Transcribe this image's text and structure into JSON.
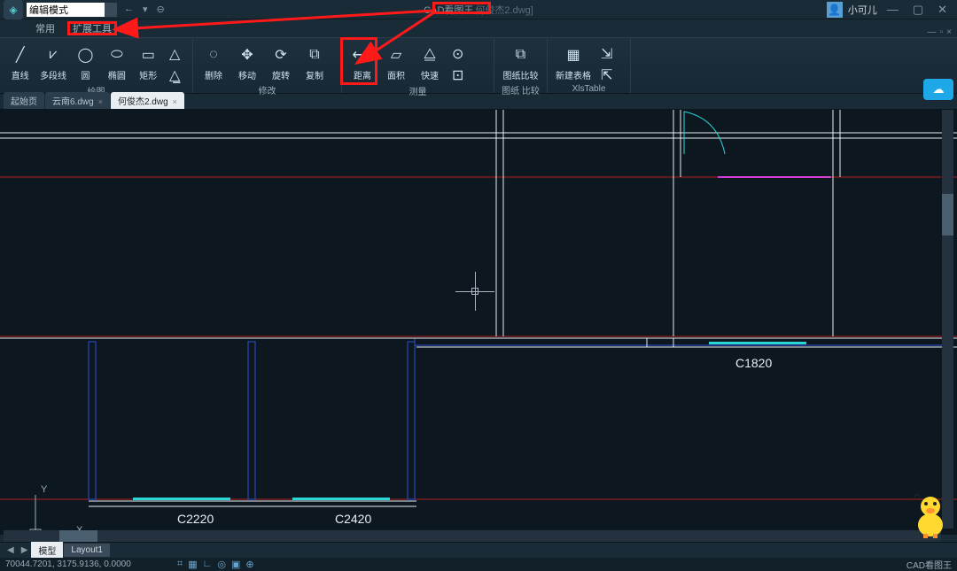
{
  "title": {
    "mode_value": "编辑模式",
    "app_badge": "CAD看图王",
    "doc_suffix": "何俊杰2.dwg]",
    "user": "小可儿"
  },
  "ribbon_tabs": {
    "common": "常用",
    "ext": "扩展工具"
  },
  "ribbon": {
    "draw": {
      "line": "直线",
      "polyline": "多段线",
      "circle": "圆",
      "ellipse": "椭圆",
      "rect": "矩形",
      "title": "绘图"
    },
    "modify": {
      "erase": "删除",
      "move": "移动",
      "rotate": "旋转",
      "copy": "复制",
      "title": "修改"
    },
    "measure": {
      "dist": "距离",
      "area": "面积",
      "quick": "快速",
      "title": "测量"
    },
    "compare": {
      "compare": "图纸比较",
      "title": "图纸 比较"
    },
    "xlstable": {
      "new": "新建表格",
      "title": "XlsTable"
    }
  },
  "file_tabs": {
    "t1": "起始页",
    "t2": "云南6.dwg",
    "t3": "何俊杰2.dwg"
  },
  "canvas_text": {
    "c1820": "C1820",
    "c2220": "C2220",
    "c2420": "C2420",
    "y": "Y",
    "x": "X"
  },
  "bottom_tabs": {
    "model": "模型",
    "layout": "Layout1"
  },
  "status": {
    "coords": "70044.7201, 3175.9136, 0.0000",
    "brand": "CAD看图王"
  }
}
